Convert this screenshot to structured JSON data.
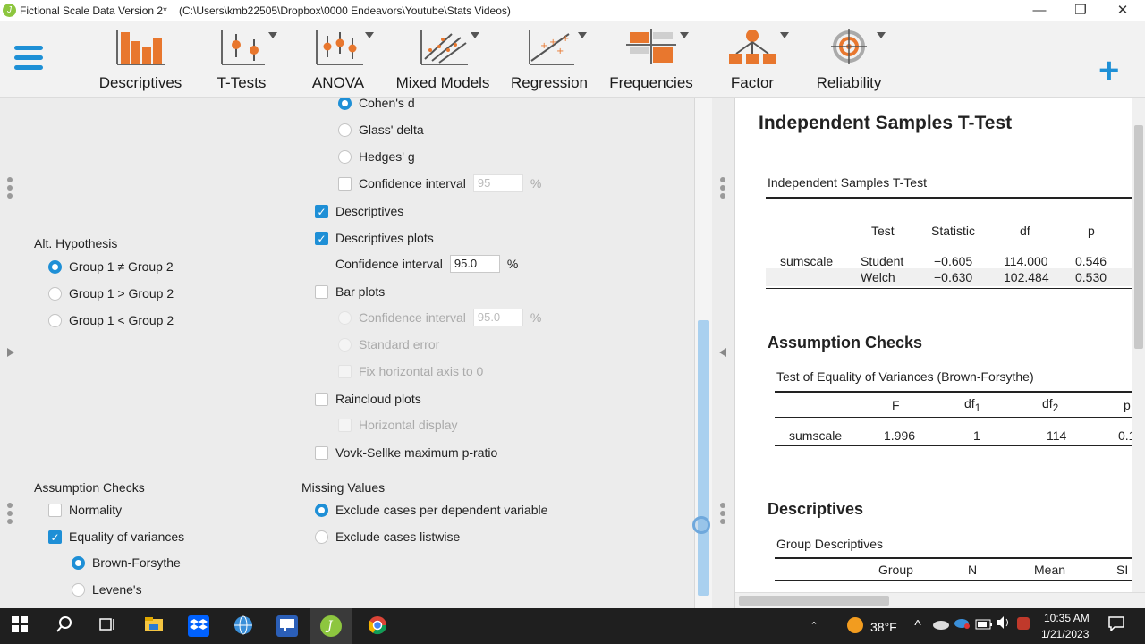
{
  "window": {
    "title": "Fictional Scale Data Version 2*",
    "path": "(C:\\Users\\kmb22505\\Dropbox\\0000 Endeavors\\Youtube\\Stats Videos)",
    "minimize": "—",
    "restore": "❐",
    "close": "✕"
  },
  "ribbon": {
    "tabs": [
      {
        "label": "Descriptives",
        "icon": "descriptives-icon"
      },
      {
        "label": "T-Tests",
        "icon": "t-tests-icon"
      },
      {
        "label": "ANOVA",
        "icon": "anova-icon"
      },
      {
        "label": "Mixed Models",
        "icon": "mixed-models-icon"
      },
      {
        "label": "Regression",
        "icon": "regression-icon"
      },
      {
        "label": "Frequencies",
        "icon": "frequencies-icon"
      },
      {
        "label": "Factor",
        "icon": "factor-icon"
      },
      {
        "label": "Reliability",
        "icon": "reliability-icon"
      }
    ],
    "add_label": "+"
  },
  "colors": {
    "accent": "#1e8fd6",
    "chart_orange": "#e8772e"
  },
  "options": {
    "effect_size": {
      "cohens_d": "Cohen's d",
      "glass_delta": "Glass' delta",
      "hedges_g": "Hedges' g",
      "ci_label": "Confidence interval",
      "ci_value": "95",
      "percent": "%"
    },
    "descriptives": "Descriptives",
    "descriptives_plots": "Descriptives plots",
    "desc_ci_label": "Confidence interval",
    "desc_ci_value": "95.0",
    "percent": "%",
    "bar_plots": "Bar plots",
    "bar_ci_label": "Confidence interval",
    "bar_ci_value": "95.0",
    "standard_error": "Standard error",
    "fix_axis": "Fix horizontal axis to 0",
    "raincloud": "Raincloud plots",
    "horizontal_display": "Horizontal display",
    "vovk": "Vovk-Sellke maximum p-ratio",
    "alt_hypothesis": {
      "title": "Alt. Hypothesis",
      "neq": "Group 1 ≠ Group 2",
      "gt": "Group 1 > Group 2",
      "lt": "Group 1 < Group 2"
    },
    "assumption_checks": {
      "title": "Assumption Checks",
      "normality": "Normality",
      "equality": "Equality of variances",
      "brown_forsythe": "Brown-Forsythe",
      "levene": "Levene's"
    },
    "missing_values": {
      "title": "Missing Values",
      "per_variable": "Exclude cases per dependent variable",
      "listwise": "Exclude cases listwise"
    }
  },
  "results": {
    "title": "Independent Samples T-Test",
    "table_title": "Independent Samples T-Test",
    "columns": [
      "Test",
      "Statistic",
      "df",
      "p"
    ],
    "variable": "sumscale",
    "rows": [
      {
        "test": "Student",
        "statistic": "−0.605",
        "df": "114.000",
        "p": "0.546"
      },
      {
        "test": "Welch",
        "statistic": "−0.630",
        "df": "102.484",
        "p": "0.530"
      }
    ],
    "assumption_title": "Assumption Checks",
    "variance_table_title": "Test of Equality of Variances (Brown-Forsythe)",
    "variance_columns": {
      "F": "F",
      "df1": "df",
      "df1_sub": "1",
      "df2": "df",
      "df2_sub": "2",
      "p": "p"
    },
    "variance_row": {
      "variable": "sumscale",
      "F": "1.996",
      "df1": "1",
      "df2": "114",
      "p": "0.1"
    },
    "descriptives_title": "Descriptives",
    "group_desc_title": "Group Descriptives",
    "group_columns": [
      "Group",
      "N",
      "Mean",
      "SI"
    ]
  },
  "taskbar": {
    "temperature": "38°F",
    "time": "10:35 AM",
    "date": "1/21/2023"
  }
}
